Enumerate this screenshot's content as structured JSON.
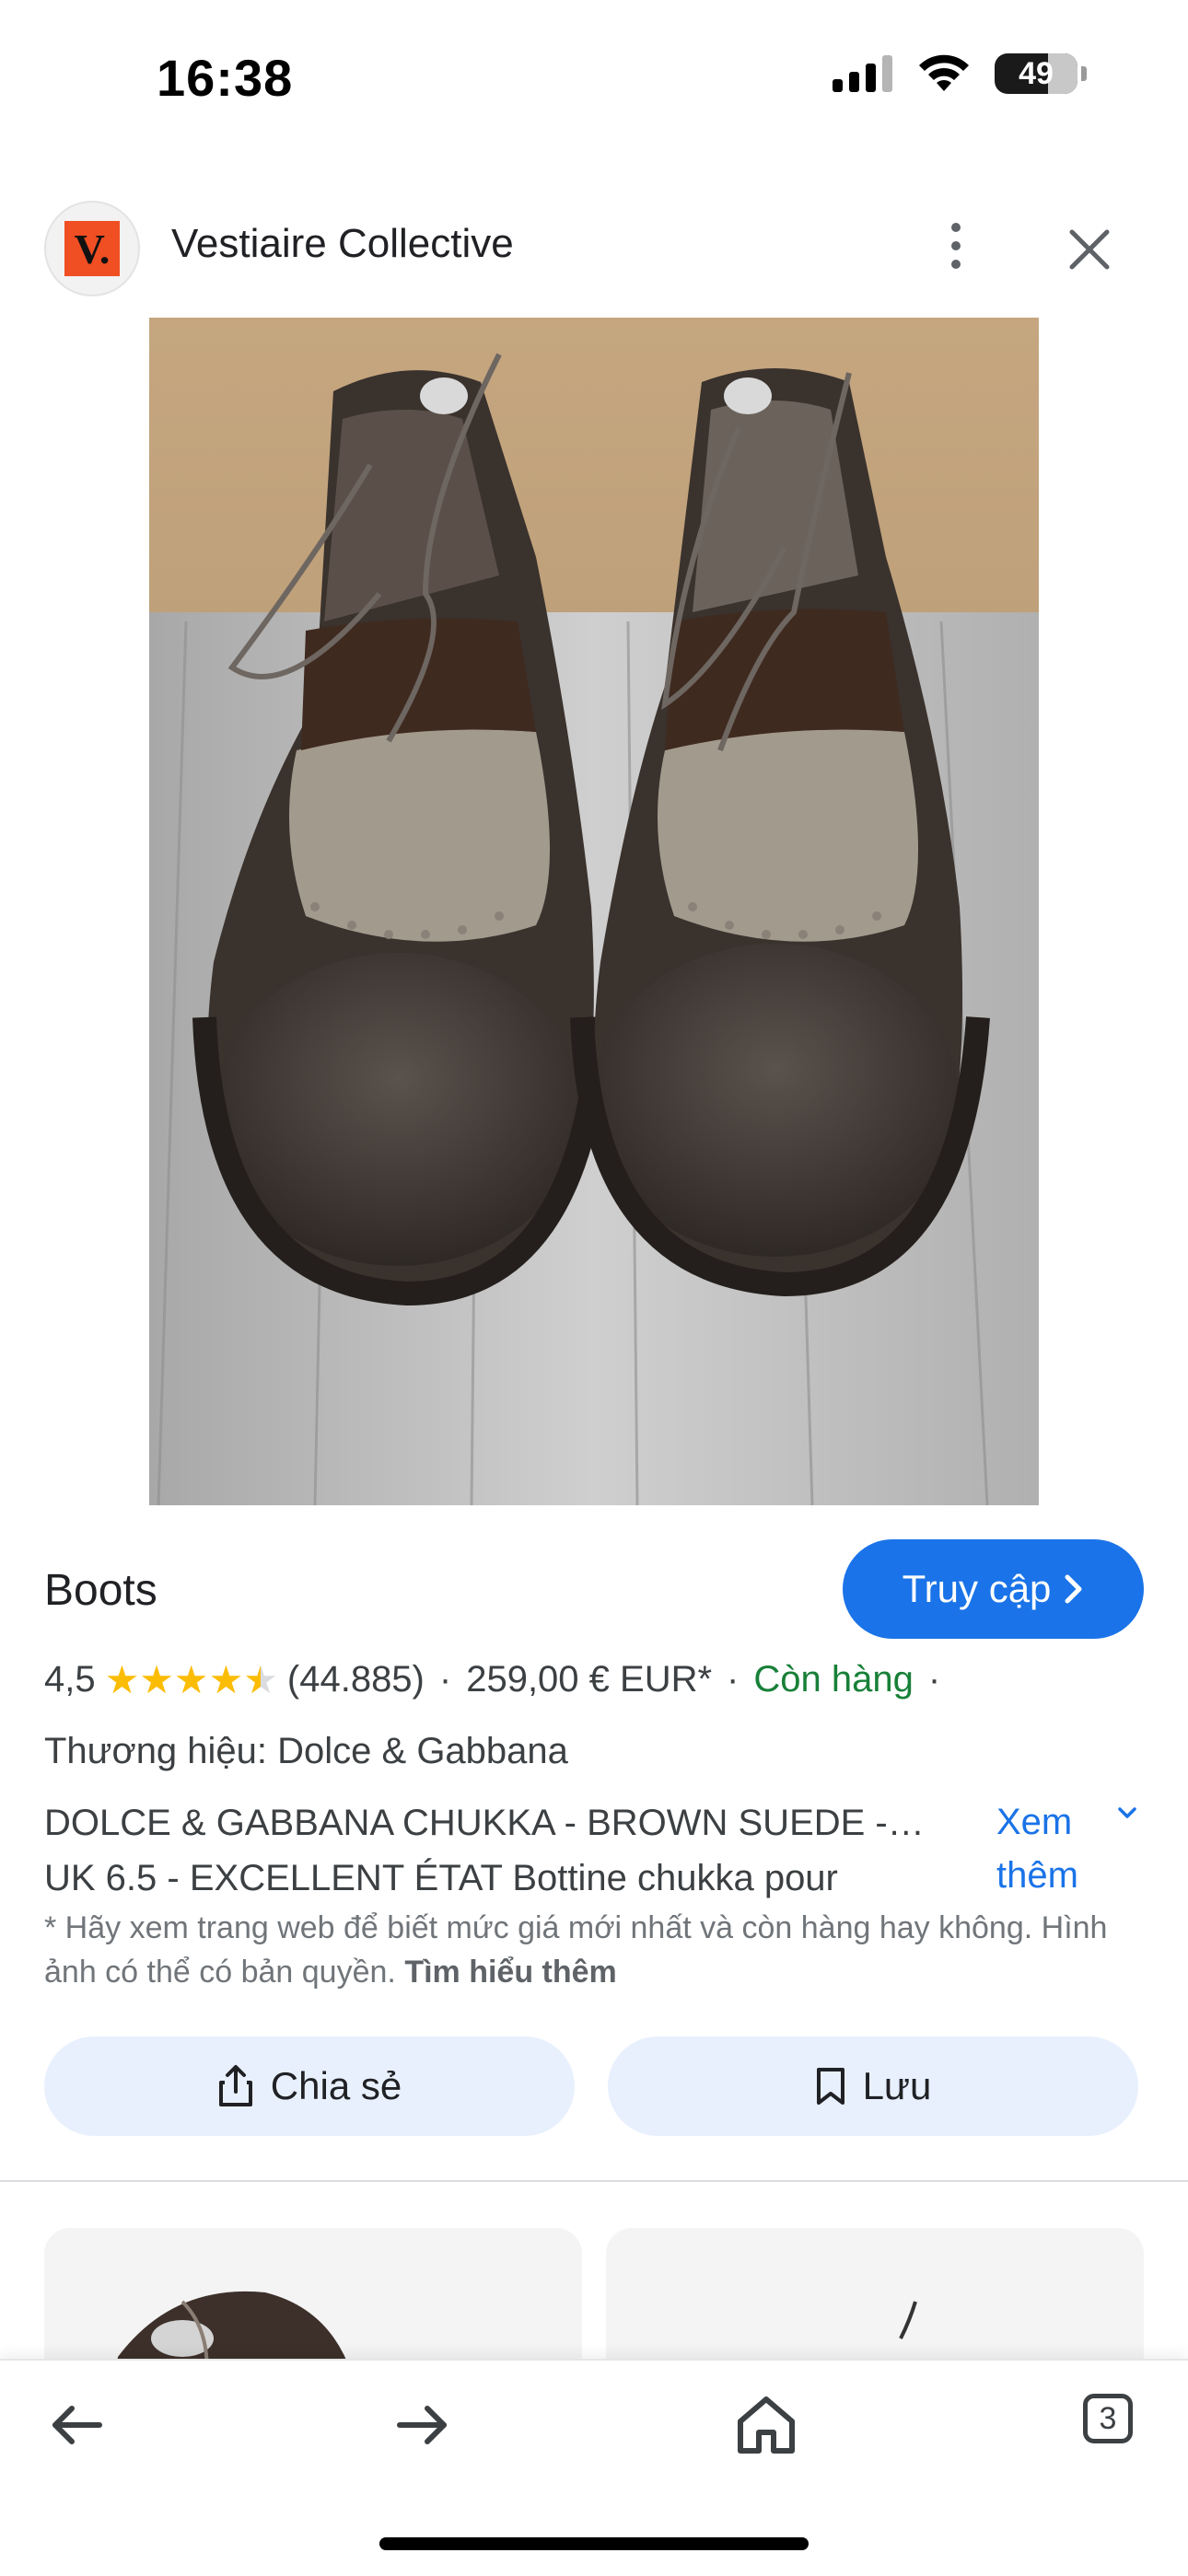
{
  "status_bar": {
    "time": "16:38",
    "battery": "49",
    "icons": [
      "signal-icon",
      "wifi-icon",
      "battery-icon"
    ]
  },
  "header": {
    "site_name": "Vestiaire Collective",
    "logo_text": "V.",
    "icons": [
      "more-vert-icon",
      "close-icon"
    ]
  },
  "product": {
    "title": "Boots",
    "visit_label": "Truy cập",
    "rating": "4,5",
    "stars": 4.5,
    "review_count": "(44.885)",
    "price": "259,00 € EUR*",
    "availability": "Còn hàng",
    "brand": "Thương hiệu: Dolce & Gabbana",
    "description_line1": "DOLCE & GABBANA CHUKKA - BROWN SUEDE -…",
    "description_line2": "UK 6.5 - EXCELLENT ÉTAT Bottine chukka pour",
    "see_more_line1": "Xem",
    "see_more_line2": "thêm",
    "disclaimer": "* Hãy xem trang web để biết mức giá mới nhất và còn hàng hay không. Hình ảnh có thể có bản quyền.",
    "learn_more": "Tìm hiểu thêm"
  },
  "actions": {
    "share_label": "Chia sẻ",
    "save_label": "Lưu"
  },
  "bottom_nav": {
    "tabs_count": "3",
    "icons": [
      "back-icon",
      "forward-icon",
      "home-icon",
      "tabs-icon"
    ]
  },
  "colors": {
    "accent": "#1a73e8",
    "availability": "#188038",
    "star": "#fbbc04",
    "button_bg": "#e8f0fe"
  }
}
